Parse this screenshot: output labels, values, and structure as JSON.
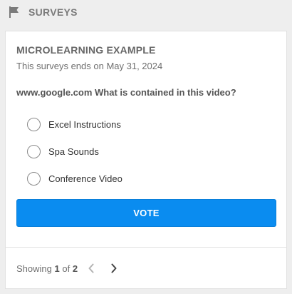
{
  "widget": {
    "icon": "flag-icon",
    "title": "SURVEYS"
  },
  "survey": {
    "title": "MICROLEARNING EXAMPLE",
    "ends_text": "This surveys ends on May 31, 2024",
    "question": "www.google.com What is contained in this video?",
    "options": [
      {
        "label": "Excel Instructions",
        "selected": false
      },
      {
        "label": "Spa Sounds",
        "selected": false
      },
      {
        "label": "Conference Video",
        "selected": false
      }
    ],
    "vote_label": "VOTE"
  },
  "pagination": {
    "prefix": "Showing",
    "current": "1",
    "of_text": "of",
    "total": "2",
    "prev_icon": "chevron-left-icon",
    "next_icon": "chevron-right-icon"
  },
  "colors": {
    "accent": "#0a8cf0",
    "background": "#eeeeee",
    "card": "#ffffff",
    "disabled_chevron": "#b5b5b5",
    "active_chevron": "#444444"
  }
}
